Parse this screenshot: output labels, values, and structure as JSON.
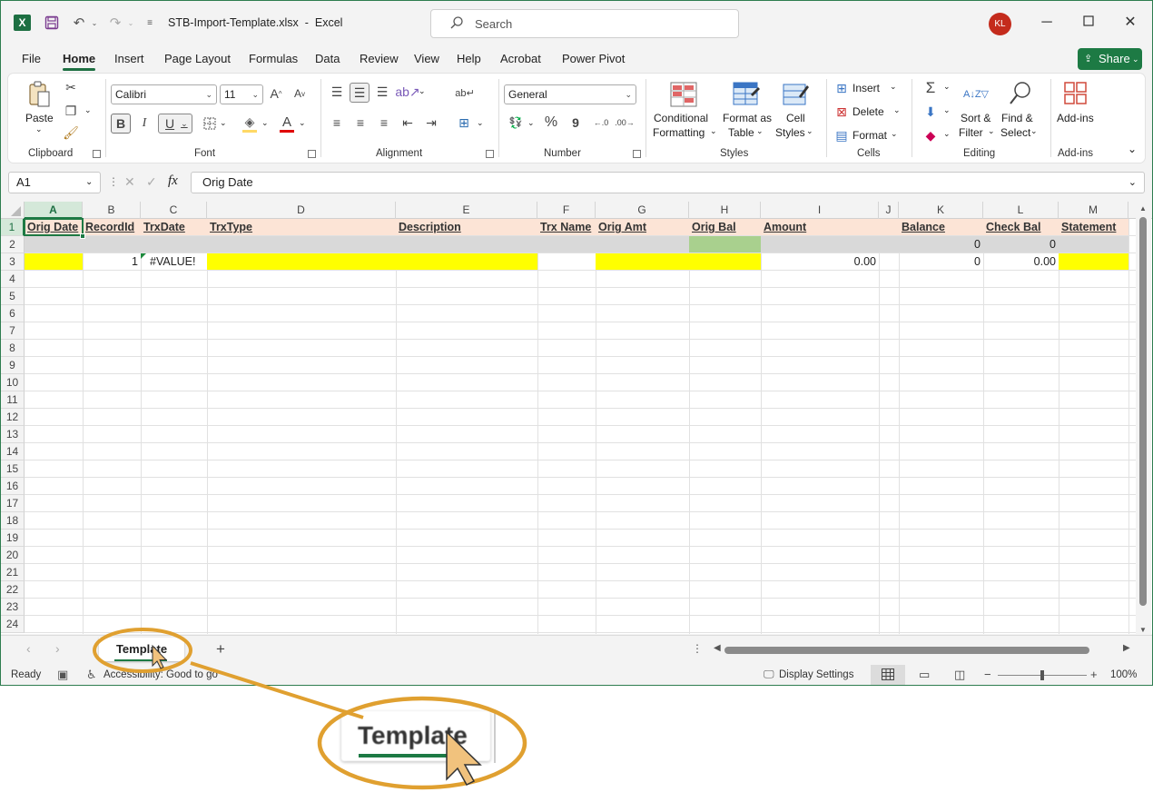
{
  "titlebar": {
    "file_name": "STB-Import-Template.xlsx",
    "separator": "-",
    "app_name": "Excel",
    "search_placeholder": "Search",
    "user_initials": "KL",
    "app_icon_letter": "X"
  },
  "menu": {
    "tabs": [
      "File",
      "Home",
      "Insert",
      "Page Layout",
      "Formulas",
      "Data",
      "Review",
      "View",
      "Help",
      "Acrobat",
      "Power Pivot"
    ],
    "active_tab": "Home",
    "share_label": "Share"
  },
  "ribbon": {
    "clipboard": {
      "paste": "Paste",
      "label": "Clipboard"
    },
    "font": {
      "name": "Calibri",
      "size": "11",
      "bold": "B",
      "italic": "I",
      "underline": "U",
      "label": "Font"
    },
    "alignment": {
      "label": "Alignment"
    },
    "number": {
      "format": "General",
      "label": "Number",
      "percent": "%",
      "comma": "9"
    },
    "styles": {
      "conditional_formatting_1": "Conditional",
      "conditional_formatting_2": "Formatting",
      "format_as_table_1": "Format as",
      "format_as_table_2": "Table",
      "cell_styles_1": "Cell",
      "cell_styles_2": "Styles",
      "label": "Styles"
    },
    "cells": {
      "insert": "Insert",
      "delete": "Delete",
      "format": "Format",
      "label": "Cells"
    },
    "editing": {
      "sort_filter_1": "Sort &",
      "sort_filter_2": "Filter",
      "find_select_1": "Find &",
      "find_select_2": "Select",
      "label": "Editing"
    },
    "addins": {
      "button": "Add-ins",
      "label": "Add-ins"
    }
  },
  "formula_bar": {
    "name_box": "A1",
    "fx": "fx",
    "content": "Orig Date"
  },
  "sheet": {
    "columns": [
      "A",
      "B",
      "C",
      "D",
      "E",
      "F",
      "G",
      "H",
      "I",
      "J",
      "K",
      "L",
      "M"
    ],
    "rows": [
      "1",
      "2",
      "3",
      "4",
      "5",
      "6",
      "7",
      "8",
      "9",
      "10",
      "11",
      "12",
      "13",
      "14",
      "15",
      "16",
      "17",
      "18",
      "19",
      "20",
      "21",
      "22",
      "23",
      "24"
    ],
    "headers": [
      "Orig Date",
      "RecordId",
      "TrxDate",
      "TrxType",
      "Description",
      "Trx Name",
      "Orig Amt",
      "Orig Bal",
      "Amount",
      "",
      "Balance",
      "Check Bal",
      "Statement"
    ],
    "row2": {
      "K": "0",
      "L": "0"
    },
    "row3": {
      "B": "1",
      "C": "#VALUE!",
      "I": "0.00",
      "K": "0",
      "L": "0.00"
    },
    "colors": {
      "header_fill": "#fce4d6",
      "row2_fill": "#d9d9d9",
      "yellow": "#ffff00",
      "green": "#a9d08e"
    }
  },
  "sheet_tabs": {
    "active": "Template",
    "add": "+"
  },
  "status": {
    "ready": "Ready",
    "accessibility": "Accessibility: Good to go",
    "display_settings": "Display Settings",
    "zoom": "100%"
  },
  "callout": {
    "zoomed_tab_label": "Template",
    "accent": "#e0a030"
  }
}
